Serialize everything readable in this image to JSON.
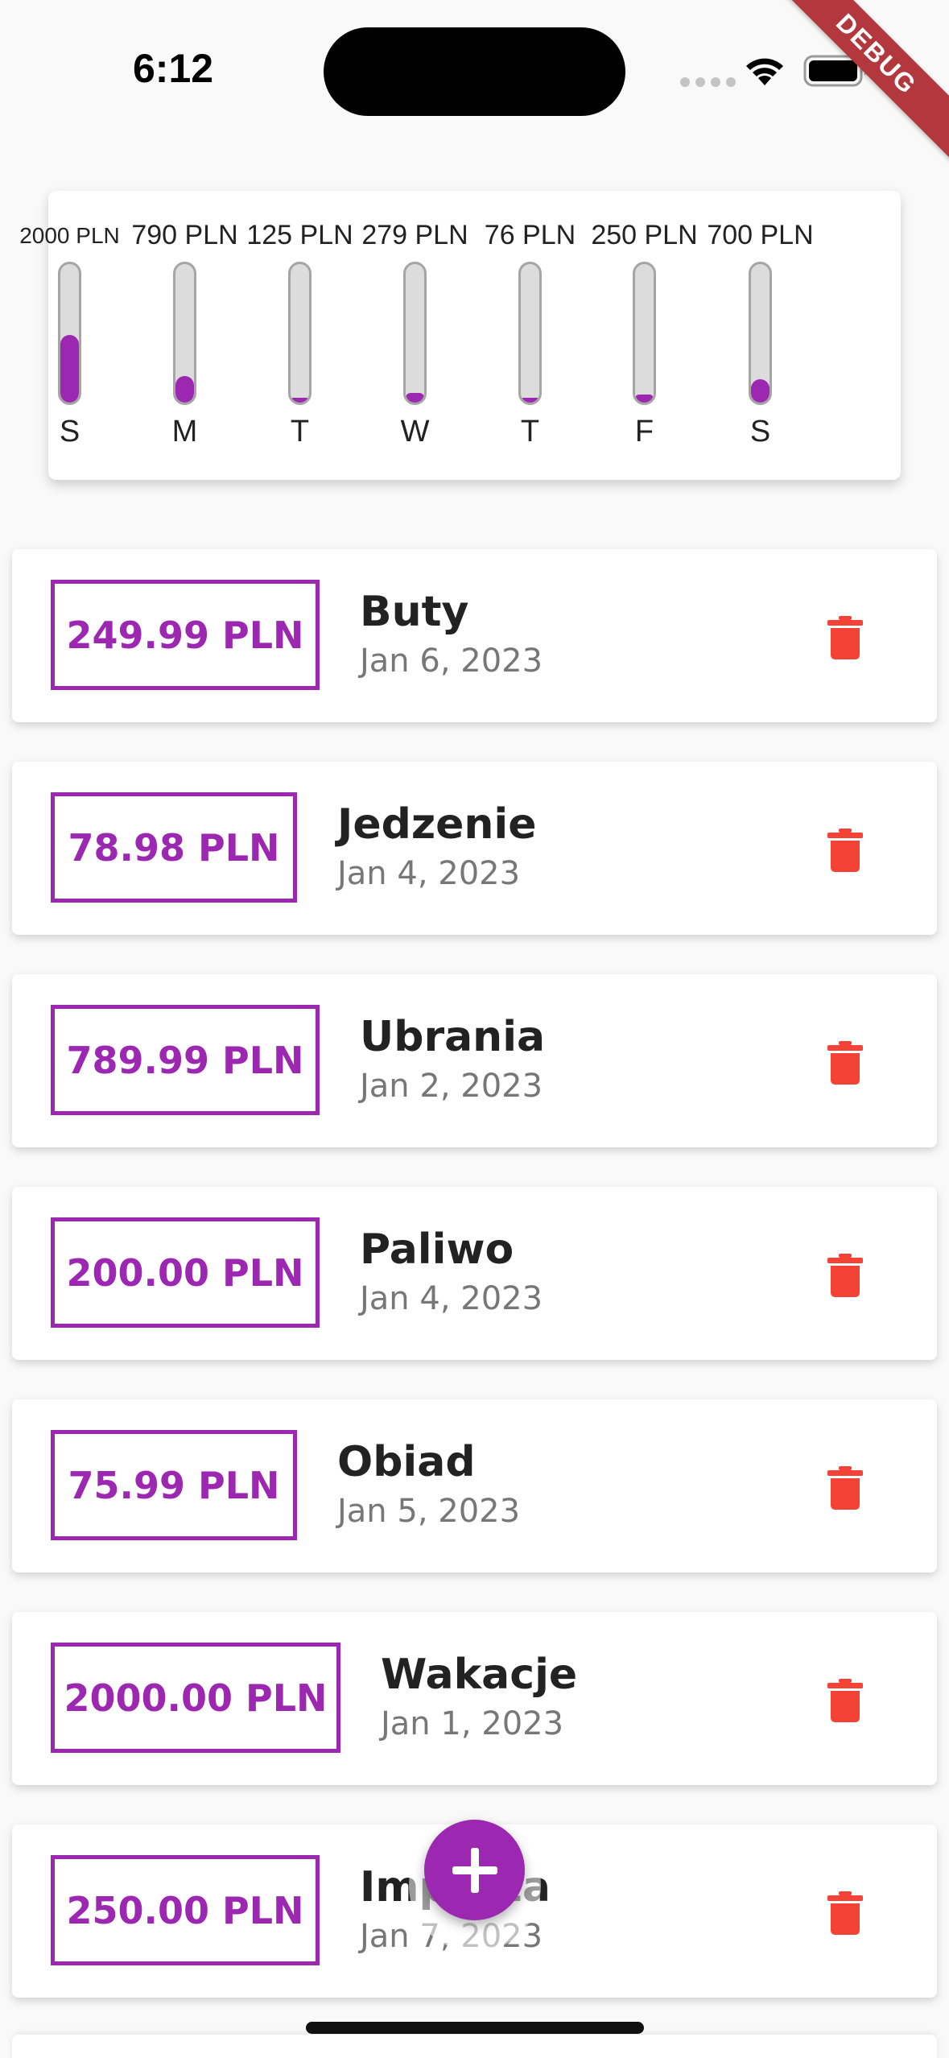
{
  "status_bar": {
    "time": "6:12"
  },
  "debug_banner": {
    "label": "DEBUG"
  },
  "chart_data": {
    "type": "bar",
    "categories": [
      "S",
      "M",
      "T",
      "W",
      "T",
      "F",
      "S"
    ],
    "value_labels": [
      "2000 PLN",
      "790 PLN",
      "125 PLN",
      "279 PLN",
      "76 PLN",
      "250 PLN",
      "700 PLN"
    ],
    "values": [
      2000,
      790,
      125,
      279,
      76,
      250,
      700
    ],
    "fill_fractions": [
      0.49,
      0.19,
      0.03,
      0.07,
      0.02,
      0.06,
      0.17
    ],
    "title": "",
    "xlabel": "",
    "ylabel": "",
    "bar_color": "#9c27b0",
    "track_color": "#dcdcdc"
  },
  "transactions": [
    {
      "amount": "249.99 PLN",
      "title": "Buty",
      "date": "Jan 6, 2023"
    },
    {
      "amount": "78.98 PLN",
      "title": "Jedzenie",
      "date": "Jan 4, 2023"
    },
    {
      "amount": "789.99 PLN",
      "title": "Ubrania",
      "date": "Jan 2, 2023"
    },
    {
      "amount": "200.00 PLN",
      "title": "Paliwo",
      "date": "Jan 4, 2023"
    },
    {
      "amount": "75.99 PLN",
      "title": "Obiad",
      "date": "Jan 5, 2023"
    },
    {
      "amount": "2000.00 PLN",
      "title": "Wakacje",
      "date": "Jan 1, 2023"
    },
    {
      "amount": "250.00 PLN",
      "title": "Impreza",
      "date": "Jan 7, 2023"
    }
  ],
  "icons": {
    "delete": "trash-icon",
    "add": "plus-icon"
  },
  "colors": {
    "accent": "#9c27b0",
    "delete": "#f44336"
  }
}
